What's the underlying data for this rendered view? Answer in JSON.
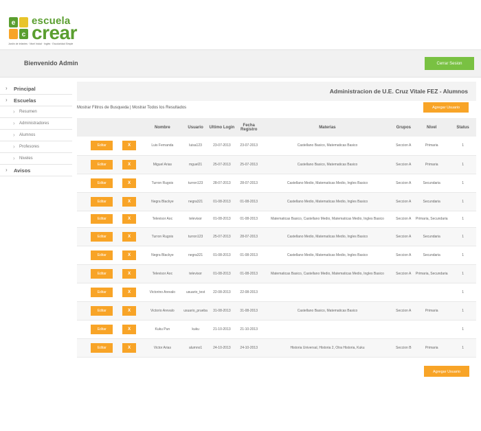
{
  "brand": {
    "name_top": "escuela",
    "name_bottom": "crear",
    "tagline": "Jardín de Infantes · Nivel Inicial · Inglés · Escolaridad Simple",
    "colors": {
      "green": "#5a9e2f",
      "orange": "#f8a427",
      "yellow": "#e8c42a"
    }
  },
  "header": {
    "welcome": "Bienvenido Admin",
    "logout_label": "Cerrar Sesion"
  },
  "sidebar": {
    "items": [
      {
        "label": "Principal",
        "icon": "chevron-right-icon"
      },
      {
        "label": "Escuelas",
        "icon": "chevron-right-icon"
      }
    ],
    "subitems": [
      {
        "label": "Resumen"
      },
      {
        "label": "Administradores"
      },
      {
        "label": "Alumnos"
      },
      {
        "label": "Profesores"
      },
      {
        "label": "Niveles"
      }
    ],
    "last_item": {
      "label": "Avisos"
    }
  },
  "main": {
    "title": "Administracion de U.E. Cruz Vitale FEZ - Alumnos",
    "filters_text": "Mostrar Filtros de Busqueda | Mostrar Todos los Resultados",
    "add_user_label": "Agregar Usuario",
    "columns": [
      "",
      "",
      "Nombre",
      "Usuario",
      "Ultimo Login",
      "Fecha Registro",
      "Materias",
      "Grupos",
      "Nivel",
      "Status"
    ],
    "edit_label": "Editar",
    "delete_label": "X",
    "rows": [
      {
        "nombre": "Luis Fernanda",
        "usuario": "luisa123",
        "login": "23-07-2013",
        "registro": "23-07-2013",
        "materias": "Castellano Basico, Matematicas Basico",
        "grupos": "Seccion A",
        "nivel": "Primaria",
        "status": "1"
      },
      {
        "nombre": "Miguel Arias",
        "usuario": "mguel21",
        "login": "25-07-2013",
        "registro": "25-07-2013",
        "materias": "Castellano Basico, Matematicas Basico",
        "grupos": "Seccion A",
        "nivel": "Primaria",
        "status": "1"
      },
      {
        "nombre": "Turron Rugois",
        "usuario": "turron123",
        "login": "28-07-2013",
        "registro": "28-07-2013",
        "materias": "Castellano Medio, Matematicas Medio, Ingles Basico",
        "grupos": "Seccion A",
        "nivel": "Secundaria",
        "status": "1"
      },
      {
        "nombre": "Negra Blackye",
        "usuario": "negra321",
        "login": "01-08-2013",
        "registro": "01-08-2013",
        "materias": "Castellano Medio, Matematicas Medio, Ingles Basico",
        "grupos": "Seccion A",
        "nivel": "Secundaria",
        "status": "1"
      },
      {
        "nombre": "Televisor Aoc",
        "usuario": "televisor",
        "login": "01-08-2013",
        "registro": "01-08-2013",
        "materias": "Matematicas Basico, Castellano Medio, Matematicas Medio, Ingles Basico",
        "grupos": "Seccion A",
        "nivel": "Primaria, Secundaria",
        "status": "1"
      },
      {
        "nombre": "Turron Rugois",
        "usuario": "turron123",
        "login": "25-07-2013",
        "registro": "28-07-2013",
        "materias": "Castellano Medio, Matematicas Medio, Ingles Basico",
        "grupos": "Seccion A",
        "nivel": "Secundaria",
        "status": "1"
      },
      {
        "nombre": "Negra Blackye",
        "usuario": "negra321",
        "login": "01-08-2013",
        "registro": "01-08-2013",
        "materias": "Castellano Medio, Matematicas Medio, Ingles Basico",
        "grupos": "Seccion A",
        "nivel": "Secundaria",
        "status": "1"
      },
      {
        "nombre": "Televisor Aoc",
        "usuario": "televisor",
        "login": "01-08-2013",
        "registro": "01-08-2013",
        "materias": "Matematicas Basico, Castellano Medio, Matematicas Medio, Ingles Basico",
        "grupos": "Seccion A",
        "nivel": "Primaria, Secundaria",
        "status": "1"
      },
      {
        "nombre": "Victorino Arevalo",
        "usuario": "usuario_test",
        "login": "22-08-2013",
        "registro": "22-08-2013",
        "materias": "",
        "grupos": "",
        "nivel": "",
        "status": "1"
      },
      {
        "nombre": "Victorio Arevalo",
        "usuario": "usuario_prueba",
        "login": "31-08-2013",
        "registro": "31-08-2013",
        "materias": "Castellano Basico, Matematicas Basico",
        "grupos": "Seccion A",
        "nivel": "Primaria",
        "status": "1"
      },
      {
        "nombre": "Kuku Pun",
        "usuario": "kuku",
        "login": "21-10-2013",
        "registro": "21-10-2013",
        "materias": "",
        "grupos": "",
        "nivel": "",
        "status": "1"
      },
      {
        "nombre": "Victor Arias",
        "usuario": "alumno1",
        "login": "24-10-2013",
        "registro": "24-10-2013",
        "materias": "Historia Universal, Historia 2, Otra Historia, Kuku",
        "grupos": "Seccion B",
        "nivel": "Primaria",
        "status": "1"
      }
    ]
  }
}
